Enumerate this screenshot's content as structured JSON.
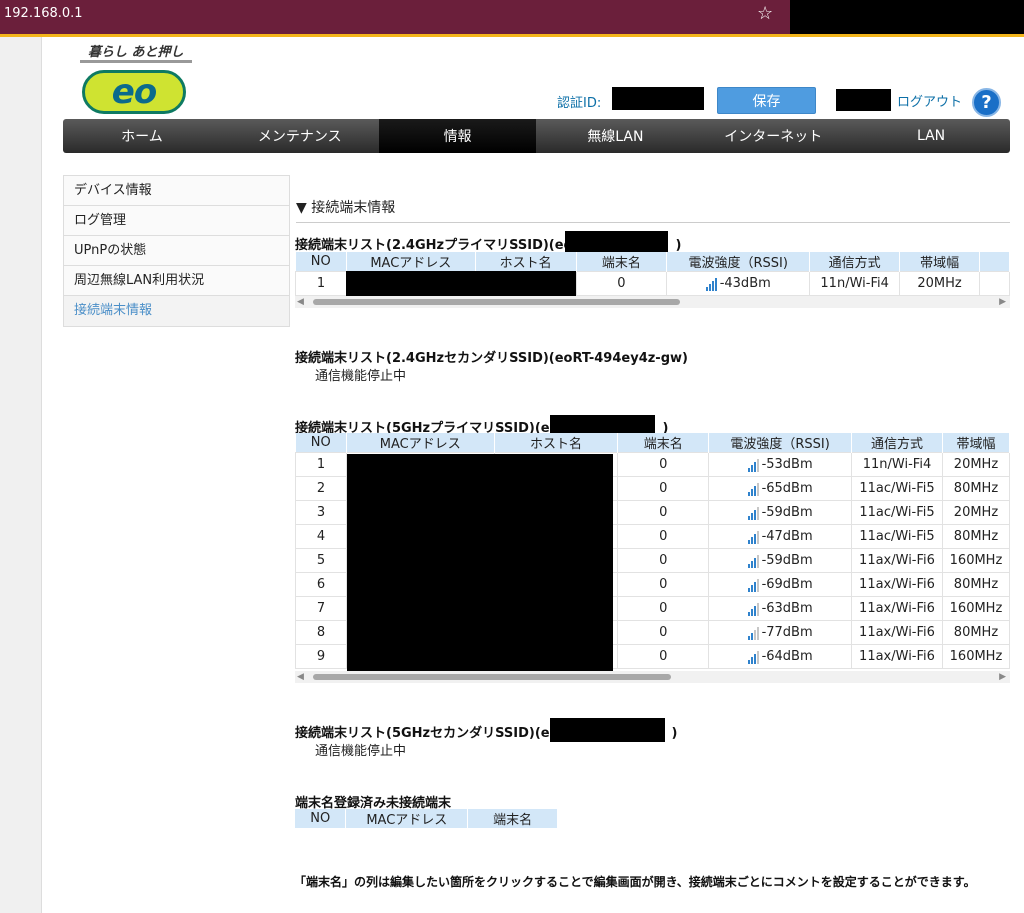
{
  "browser": {
    "url": "192.168.0.1",
    "star_icon": "☆"
  },
  "logo": {
    "tagline": "暮らし あと押し",
    "text": "eo"
  },
  "header": {
    "auth_label": "認証ID:",
    "save_label": "保存",
    "logout_label": "ログアウト",
    "help_label": "?"
  },
  "nav": [
    "ホーム",
    "メンテナンス",
    "情報",
    "無線LAN",
    "インターネット",
    "LAN"
  ],
  "sidebar": [
    "デバイス情報",
    "ログ管理",
    "UPnPの状態",
    "周辺無線LAN利用状況",
    "接続端末情報"
  ],
  "section_title": "▼ 接続端末情報",
  "list1": {
    "heading_prefix": "接続端末リスト(2.4GHzプライマリSSID)(eo",
    "heading_suffix": ")",
    "headers": [
      "NO",
      "MACアドレス",
      "ホスト名",
      "端末名",
      "電波強度（RSSI)",
      "通信方式",
      "帯域幅"
    ],
    "rows": [
      {
        "no": "1",
        "name": "0",
        "rssi": "-43dBm",
        "mode": "11n/Wi-Fi4",
        "bw": "20MHz",
        "bars": 4
      }
    ]
  },
  "list2": {
    "heading": "接続端末リスト(2.4GHzセカンダリSSID)(eoRT-494ey4z-gw)",
    "status": "通信機能停止中"
  },
  "list3": {
    "heading_prefix": "接続端末リスト(5GHzプライマリSSID)(eo",
    "heading_suffix": ")",
    "headers": [
      "NO",
      "MACアドレス",
      "ホスト名",
      "端末名",
      "電波強度（RSSI)",
      "通信方式",
      "帯域幅"
    ],
    "rows": [
      {
        "no": "1",
        "name": "0",
        "rssi": "-53dBm",
        "mode": "11n/Wi-Fi4",
        "bw": "20MHz",
        "bars": 3
      },
      {
        "no": "2",
        "name": "0",
        "rssi": "-65dBm",
        "mode": "11ac/Wi-Fi5",
        "bw": "80MHz",
        "bars": 3
      },
      {
        "no": "3",
        "name": "0",
        "rssi": "-59dBm",
        "mode": "11ac/Wi-Fi5",
        "bw": "20MHz",
        "bars": 3
      },
      {
        "no": "4",
        "name": "0",
        "rssi": "-47dBm",
        "mode": "11ac/Wi-Fi5",
        "bw": "80MHz",
        "bars": 3
      },
      {
        "no": "5",
        "name": "0",
        "rssi": "-59dBm",
        "mode": "11ax/Wi-Fi6",
        "bw": "160MHz",
        "bars": 3
      },
      {
        "no": "6",
        "name": "0",
        "rssi": "-69dBm",
        "mode": "11ax/Wi-Fi6",
        "bw": "80MHz",
        "bars": 3
      },
      {
        "no": "7",
        "name": "0",
        "rssi": "-63dBm",
        "mode": "11ax/Wi-Fi6",
        "bw": "160MHz",
        "bars": 3
      },
      {
        "no": "8",
        "name": "0",
        "rssi": "-77dBm",
        "mode": "11ax/Wi-Fi6",
        "bw": "80MHz",
        "bars": 2
      },
      {
        "no": "9",
        "name": "0",
        "rssi": "-64dBm",
        "mode": "11ax/Wi-Fi6",
        "bw": "160MHz",
        "bars": 3
      }
    ]
  },
  "list4": {
    "heading_prefix": "接続端末リスト(5GHzセカンダリSSID)(eo",
    "heading_suffix": ")",
    "status": "通信機能停止中"
  },
  "registered": {
    "heading": "端末名登録済み未接続端末",
    "headers": [
      "NO",
      "MACアドレス",
      "端末名"
    ]
  },
  "footer_note": "「端末名」の列は編集したい箇所をクリックすることで編集画面が開き、接続端末ごとにコメントを設定することができます。",
  "colors": {
    "accent": "#4f9ce0",
    "nav_bg": "#333333",
    "table_header": "#d3e7f8",
    "browser": "#6b1f3b"
  }
}
